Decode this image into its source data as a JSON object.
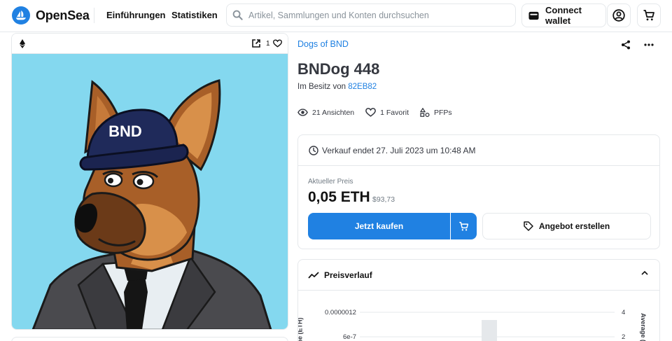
{
  "header": {
    "brand": "OpenSea",
    "nav": [
      "Einführungen",
      "Statistiken"
    ],
    "search_placeholder": "Artikel, Sammlungen und Konten durchsuchen",
    "connect_wallet": "Connect wallet"
  },
  "media": {
    "chain_icon": "ethereum-icon",
    "favorites_count": "1",
    "image_alt": "Cartoon German shepherd dog wearing a navy BND cap, suit and black tie",
    "cap_text": "BND",
    "background_color": "#84d8ef"
  },
  "item": {
    "collection": "Dogs of BND",
    "title": "BNDog 448",
    "owner_prefix": "Im Besitz von",
    "owner_name": "82EB82",
    "views": "21 Ansichten",
    "favorites": "1 Favorit",
    "category": "PFPs"
  },
  "sale": {
    "ends": "Verkauf endet 27. Juli 2023 um 10:48 AM",
    "price_label": "Aktueller Preis",
    "price": "0,05 ETH",
    "price_fiat": "$93,73",
    "buy_label": "Jetzt kaufen",
    "offer_label": "Angebot erstellen"
  },
  "history": {
    "title": "Preisverlauf",
    "y_left_ticks": [
      "0.0000012",
      "6e-7"
    ],
    "y_right_ticks": [
      "4",
      "2"
    ],
    "y_left_label": "ne (ETH)",
    "y_right_label": "Average (ETH)"
  },
  "colors": {
    "accent": "#2081e2",
    "border": "#e5e8eb",
    "text": "#353840"
  }
}
